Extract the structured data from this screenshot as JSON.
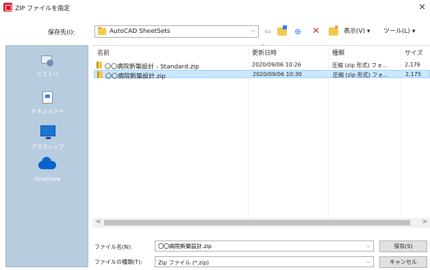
{
  "window": {
    "title": "ZIP ファイルを指定",
    "close": "×"
  },
  "toolbar": {
    "save_in_label": "保存先(I):",
    "folder": "AutoCAD SheetSets",
    "back_glyph": "⇦",
    "search_glyph": "⊕",
    "delete_glyph": "✕",
    "view_label": "表示(V) ▾",
    "tools_label": "ツール(L) ▾"
  },
  "places": [
    {
      "label": "ヒストリ",
      "icon": "history-icon"
    },
    {
      "label": "ドキュメント",
      "icon": "documents-icon"
    },
    {
      "label": "デスクトップ",
      "icon": "desktop-icon"
    },
    {
      "label": "OneDrive",
      "icon": "onedrive-icon"
    }
  ],
  "columns": {
    "name": "名前",
    "date": "更新日時",
    "type": "種類",
    "size": "サイズ"
  },
  "files": [
    {
      "name": "〇〇病院新築設計 - Standard.zip",
      "date": "2020/09/06 10:26",
      "type": "圧縮 (zip 形式) フォ...",
      "size": "2,176",
      "selected": false
    },
    {
      "name": "〇〇病院新築設計.zip",
      "date": "2020/09/06 10:30",
      "type": "圧縮 (zip 形式) フォ...",
      "size": "2,175",
      "selected": true
    }
  ],
  "bottom": {
    "filename_label": "ファイル名(N):",
    "filename_value": "〇〇病院新築設計.zip",
    "filetype_label": "ファイルの種類(T):",
    "filetype_value": "Zip ファイル (*.zip)",
    "save_button": "保存(S)",
    "cancel_button": "キャンセル"
  }
}
